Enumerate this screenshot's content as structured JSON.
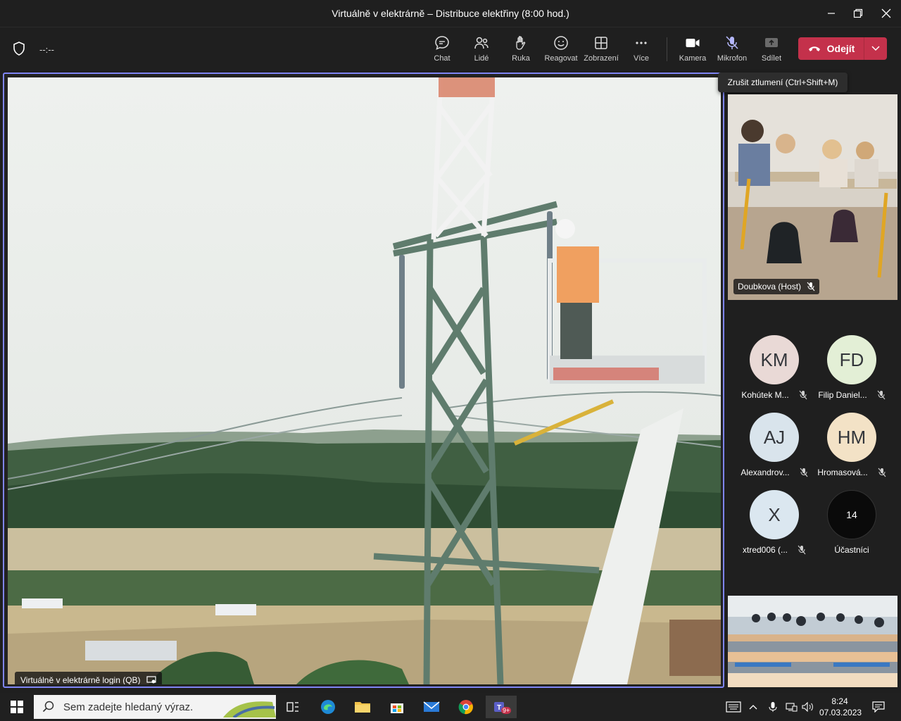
{
  "window": {
    "title": "Virtuálně v elektrárně – Distribuce elektřiny (8:00 hod.)"
  },
  "toolbar": {
    "timer": "--:--",
    "chat": "Chat",
    "people": "Lidé",
    "hand": "Ruka",
    "react": "Reagovat",
    "view": "Zobrazení",
    "more": "Více",
    "camera": "Kamera",
    "mic": "Mikrofon",
    "share": "Sdílet",
    "leave": "Odejít"
  },
  "tooltip": "Zrušit ztlumení (Ctrl+Shift+M)",
  "stage": {
    "presenter": "Virtuálně v elektrárně login (QB)"
  },
  "tile": {
    "name": "Doubkova (Host)"
  },
  "participants": [
    {
      "initials": "KM",
      "name": "Kohútek M...",
      "bg": "#e9d9d6"
    },
    {
      "initials": "FD",
      "name": "Filip Daniel...",
      "bg": "#e3efd6"
    },
    {
      "initials": "AJ",
      "name": "Alexandrov...",
      "bg": "#d9e4ec"
    },
    {
      "initials": "HM",
      "name": "Hromasová...",
      "bg": "#f3e2c6"
    },
    {
      "initials": "X",
      "name": "xtred006 (...",
      "bg": "#dbe7f0"
    }
  ],
  "participants_more": {
    "count": "14",
    "label": "Účastníci"
  },
  "taskbar": {
    "search_placeholder": "Sem zadejte hledaný výraz.",
    "time": "8:24",
    "date": "07.03.2023",
    "teams_badge": "9+"
  },
  "colors": {
    "accent": "#7f85f5",
    "leave": "#c4314b"
  }
}
